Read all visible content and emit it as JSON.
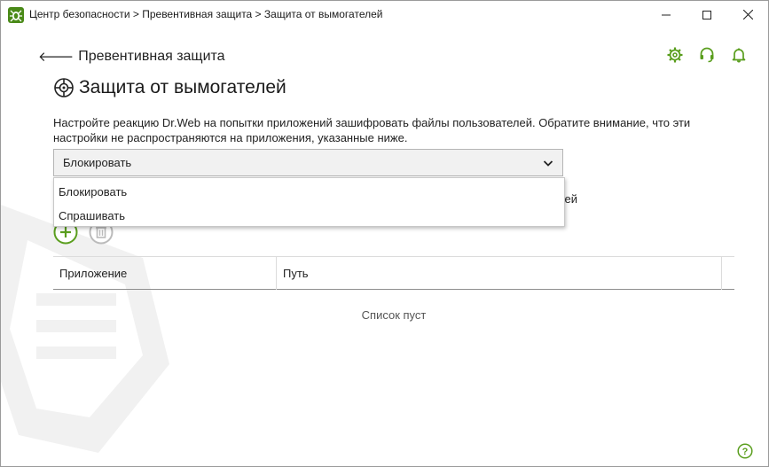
{
  "window": {
    "title": "Центр безопасности > Превентивная защита > Защита от вымогателей"
  },
  "header": {
    "back_label": "Превентивная защита",
    "page_title": "Защита от вымогателей"
  },
  "description": "Настройте реакцию Dr.Web на попытки приложений зашифровать файлы пользователей. Обратите внимание, что эти настройки не распространяются на приложения, указанные ниже.",
  "reaction_select": {
    "selected": "Блокировать",
    "options": [
      "Блокировать",
      "Спрашивать"
    ]
  },
  "exclusions_label_fragment": "ей:",
  "table": {
    "columns": [
      "Приложение",
      "Путь"
    ],
    "empty_message": "Список пуст"
  },
  "colors": {
    "accent": "#5a9e1e",
    "icon_gray": "#bbbbbb"
  },
  "icons": {
    "app": "drweb-spider-icon",
    "settings": "gear-icon",
    "support": "headset-icon",
    "notifications": "bell-icon",
    "title": "ransomware-shield-icon",
    "add": "plus-icon",
    "delete": "trash-icon",
    "help": "question-icon"
  }
}
